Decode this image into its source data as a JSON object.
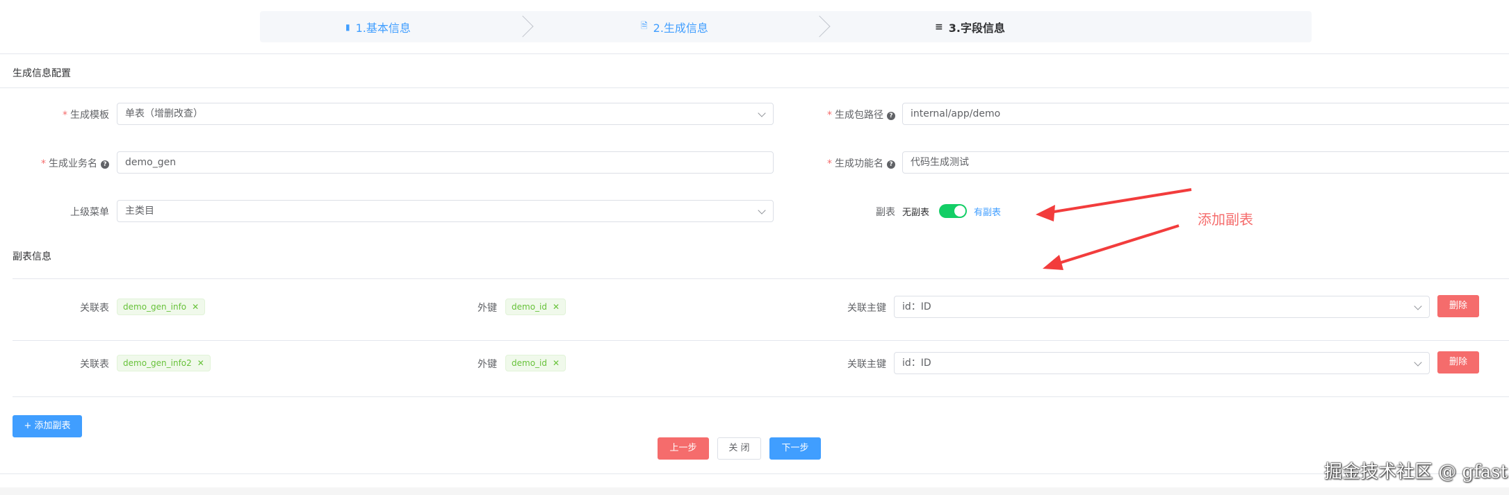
{
  "steps": [
    {
      "label": "1.基本信息",
      "icon": "chat-icon"
    },
    {
      "label": "2.生成信息",
      "icon": "document-icon"
    },
    {
      "label": "3.字段信息",
      "icon": "list-icon"
    }
  ],
  "gen_config": {
    "title": "生成信息配置",
    "template_label": "生成模板",
    "template_value": "单表（增删改查）",
    "package_label": "生成包路径",
    "package_value": "internal/app/demo",
    "business_label": "生成业务名",
    "business_value": "demo_gen",
    "function_label": "生成功能名",
    "function_value": "代码生成测试",
    "parent_menu_label": "上级菜单",
    "parent_menu_value": "主类目",
    "subtable_label": "副表",
    "subtable_off": "无副表",
    "subtable_on": "有副表",
    "subtable_enabled": true
  },
  "subtable_info": {
    "title": "副表信息",
    "rows": [
      {
        "rel_table_label": "关联表",
        "rel_table": "demo_gen_info",
        "fk_label": "外键",
        "fk": "demo_id",
        "pk_label": "关联主键",
        "pk": "id：ID",
        "delete": "删除"
      },
      {
        "rel_table_label": "关联表",
        "rel_table": "demo_gen_info2",
        "fk_label": "外键",
        "fk": "demo_id",
        "pk_label": "关联主键",
        "pk": "id：ID",
        "delete": "删除"
      }
    ],
    "add_button": "+ 添加副表"
  },
  "footer": {
    "prev": "上一步",
    "close": "关 闭",
    "next": "下一步"
  },
  "annotation": "添加副表",
  "watermark": "掘金技术社区 @ gfast",
  "colors": {
    "primary": "#409eff",
    "danger": "#f56c6c",
    "success": "#13ce66",
    "annotation": "#f23c3c"
  }
}
